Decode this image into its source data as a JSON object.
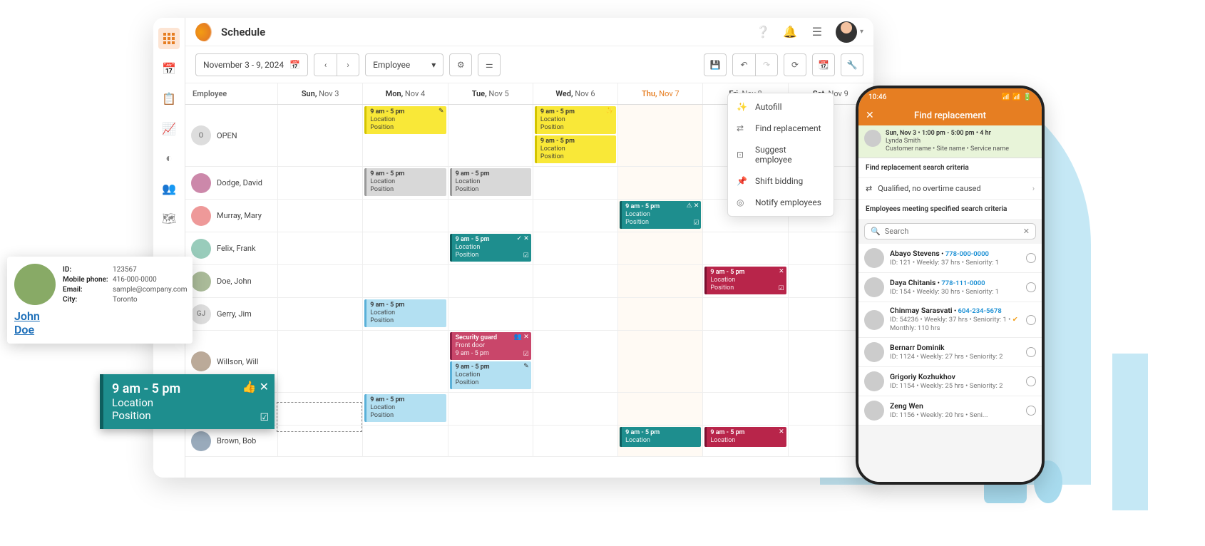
{
  "app": {
    "title": "Schedule"
  },
  "toolbar": {
    "date_range": "November 3 - 9, 2024",
    "view_dropdown": "Employee"
  },
  "columns": {
    "employee": "Employee",
    "days": [
      {
        "name": "Sun,",
        "date": " Nov 3"
      },
      {
        "name": "Mon,",
        "date": " Nov 4"
      },
      {
        "name": "Tue,",
        "date": " Nov 5"
      },
      {
        "name": "Wed,",
        "date": " Nov 6"
      },
      {
        "name": "Thu,",
        "date": " Nov 7"
      },
      {
        "name": "Fri,",
        "date": " Nov 8"
      },
      {
        "name": "Sat,",
        "date": " Nov 9"
      }
    ]
  },
  "rows": [
    {
      "initials": "O",
      "name": "OPEN"
    },
    {
      "name": "Dodge, David"
    },
    {
      "name": "Murray, Mary"
    },
    {
      "name": "Felix, Frank"
    },
    {
      "name": "Doe, John"
    },
    {
      "initials": "GJ",
      "name": "Gerry, Jim"
    },
    {
      "name": "Willson, Will"
    },
    {
      "name": ""
    },
    {
      "name": "Brown, Bob"
    }
  ],
  "generic_shift": {
    "time": "9 am - 5 pm",
    "loc": "Location",
    "pos": "Position"
  },
  "security_shift": {
    "title": "Security guard",
    "loc": "Front door",
    "time": "9 am - 5 pm"
  },
  "menu": {
    "autofill": "Autofill",
    "find_replacement": "Find replacement",
    "suggest_employee": "Suggest employee",
    "shift_bidding": "Shift bidding",
    "notify_employees": "Notify employees"
  },
  "emp_card": {
    "name": "John Doe",
    "id_label": "ID:",
    "id": "123567",
    "phone_label": "Mobile phone:",
    "phone": "416-000-0000",
    "email_label": "Email:",
    "email": "sample@company.com",
    "city_label": "City:",
    "city": "Toronto"
  },
  "drag_shift": {
    "time": "9 am - 5 pm",
    "loc": "Location",
    "pos": "Position"
  },
  "phone": {
    "time": "10:46",
    "title": "Find replacement",
    "summary": {
      "header": "Sun, Nov 3 • 1:00 pm - 5:00 pm • 4 hr",
      "name": "Lynda Smith",
      "detail": "Customer name • Site name • Service name"
    },
    "criteria_title": "Find replacement search criteria",
    "criteria_value": "Qualified, no overtime caused",
    "meeting_title": "Employees meeting specified search criteria",
    "search_placeholder": "Search",
    "employees": [
      {
        "name": "Abayo Stevens",
        "phone": "778-000-0000",
        "detail": "ID: 121 • Weekly: 37 hrs • Seniority: 1"
      },
      {
        "name": "Daya Chitanis",
        "phone": "778-111-0000",
        "detail": "ID: 154 • Weekly: 30 hrs • Seniority: 1"
      },
      {
        "name": "Chinmay Sarasvati",
        "phone": "604-234-5678",
        "detail": "ID: 54236 • Weekly: 37 hrs • Seniority: 1 •",
        "detail2": "Monthly: 110 hrs",
        "verified": true
      },
      {
        "name": "Bernarr Dominik",
        "phone": "",
        "detail": "ID: 1124 • Weekly: 27 hrs • Seniority: 2"
      },
      {
        "name": "Grigoriy Kozhukhov",
        "phone": "",
        "detail": "ID: 1154 • Weekly: 25 hrs • Seniority: 2"
      },
      {
        "name": "Zeng Wen",
        "phone": "",
        "detail": "ID: 1156 • Weekly: 20 hrs • Seni..."
      }
    ]
  }
}
